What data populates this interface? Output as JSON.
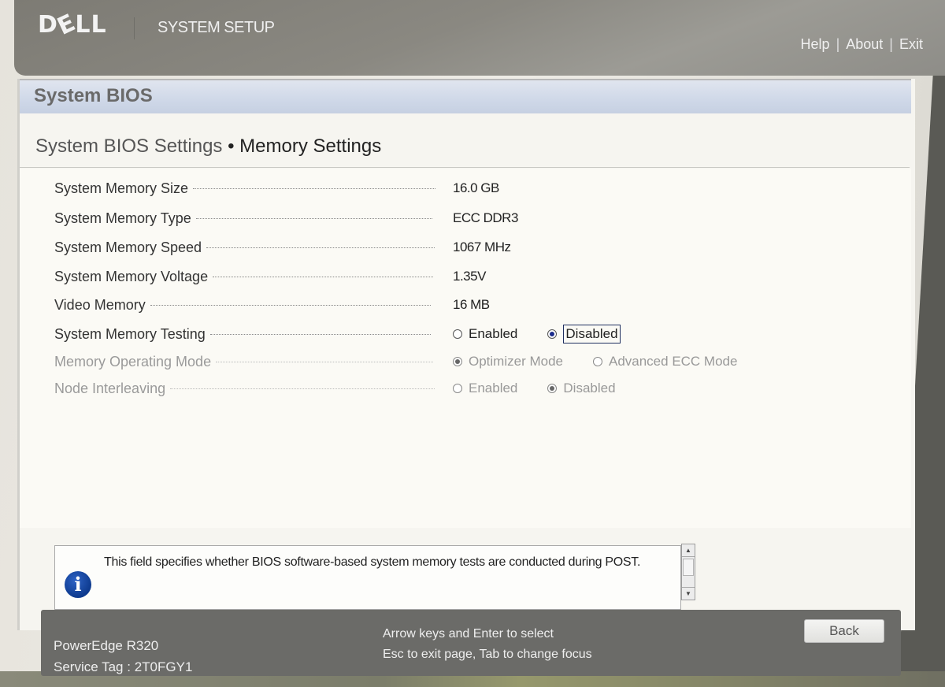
{
  "header": {
    "logo": "DELL",
    "title": "SYSTEM SETUP",
    "links": [
      {
        "label": "Help"
      },
      {
        "label": "About"
      },
      {
        "label": "Exit"
      }
    ],
    "separator": "|"
  },
  "section": {
    "title": "System BIOS"
  },
  "page": {
    "breadcrumb_parent": "System BIOS Settings",
    "breadcrumb_separator": "•",
    "breadcrumb_current": "Memory Settings"
  },
  "settings": {
    "info_rows": [
      {
        "label": "System Memory Size",
        "value": "16.0 GB"
      },
      {
        "label": "System Memory Type",
        "value": "ECC DDR3"
      },
      {
        "label": "System Memory Speed",
        "value": "1067 MHz"
      },
      {
        "label": "System Memory Voltage",
        "value": "1.35V"
      },
      {
        "label": "Video Memory",
        "value": "16 MB"
      }
    ],
    "radio_rows": [
      {
        "label": "System Memory Testing",
        "enabled": true,
        "options": [
          "Enabled",
          "Disabled"
        ],
        "selected": "Disabled",
        "focused": "Disabled"
      },
      {
        "label": "Memory Operating Mode",
        "enabled": false,
        "options": [
          "Optimizer Mode",
          "Advanced ECC Mode"
        ],
        "selected": "Optimizer Mode"
      },
      {
        "label": "Node Interleaving",
        "enabled": false,
        "options": [
          "Enabled",
          "Disabled"
        ],
        "selected": "Disabled"
      }
    ]
  },
  "help": {
    "icon": "info-icon",
    "text": "This field specifies whether BIOS software-based system memory tests are conducted during POST."
  },
  "footer": {
    "model": "PowerEdge R320",
    "service_tag_label": "Service Tag :",
    "service_tag": "2T0FGY1",
    "hint_line1": "Arrow keys and Enter to select",
    "hint_line2": "Esc to exit page, Tab to change focus",
    "back_label": "Back"
  }
}
